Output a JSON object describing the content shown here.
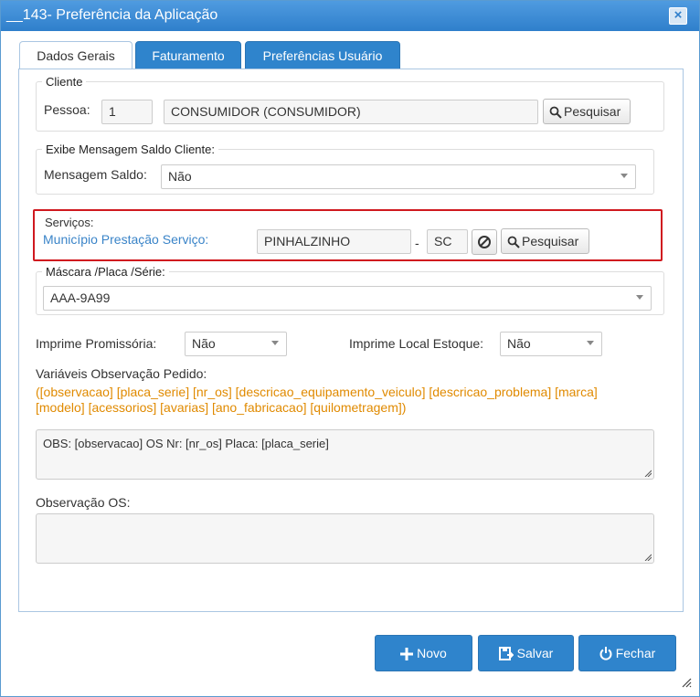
{
  "window": {
    "title": "__143- Preferência da Aplicação",
    "close_glyph": "×"
  },
  "tabs": [
    {
      "label": "Dados Gerais",
      "active": true
    },
    {
      "label": "Faturamento",
      "active": false
    },
    {
      "label": "Preferências Usuário",
      "active": false
    }
  ],
  "cliente": {
    "legend": "Cliente",
    "pessoa_label": "Pessoa:",
    "pessoa_id": "1",
    "pessoa_nome": "CONSUMIDOR (CONSUMIDOR)",
    "search_label": "Pesquisar"
  },
  "mensagem_saldo": {
    "legend": "Exibe Mensagem Saldo Cliente:",
    "label": "Mensagem Saldo:",
    "value": "Não"
  },
  "servicos": {
    "legend": "Serviços:",
    "label": "Município Prestação Serviço:",
    "municipio": "PINHALZINHO",
    "separator": "-",
    "uf": "SC",
    "search_label": "Pesquisar"
  },
  "mascara": {
    "legend": "Máscara /Placa /Série:",
    "value": "AAA-9A99"
  },
  "imprime_promissoria": {
    "label": "Imprime Promissória:",
    "value": "Não"
  },
  "imprime_local_estoque": {
    "label": "Imprime Local Estoque:",
    "value": "Não"
  },
  "variaveis": {
    "label": "Variáveis Observação Pedido:",
    "line1": "([observacao] [placa_serie] [nr_os] [descricao_equipamento_veiculo] [descricao_problema] [marca]",
    "line2": "[modelo] [acessorios] [avarias] [ano_fabricacao] [quilometragem])"
  },
  "observacao_pedido": {
    "value": "OBS: [observacao] OS Nr: [nr_os]  Placa: [placa_serie]"
  },
  "observacao_os": {
    "label": "Observação OS:",
    "value": ""
  },
  "buttons": {
    "novo": "Novo",
    "salvar": "Salvar",
    "fechar": "Fechar"
  },
  "colors": {
    "primary": "#2f84cc",
    "highlight": "#d0191f",
    "note": "#e08a00",
    "link_label": "#3a84c8"
  },
  "icons": [
    "close-icon",
    "search-icon",
    "clear-icon",
    "plus-icon",
    "save-icon",
    "power-icon"
  ]
}
